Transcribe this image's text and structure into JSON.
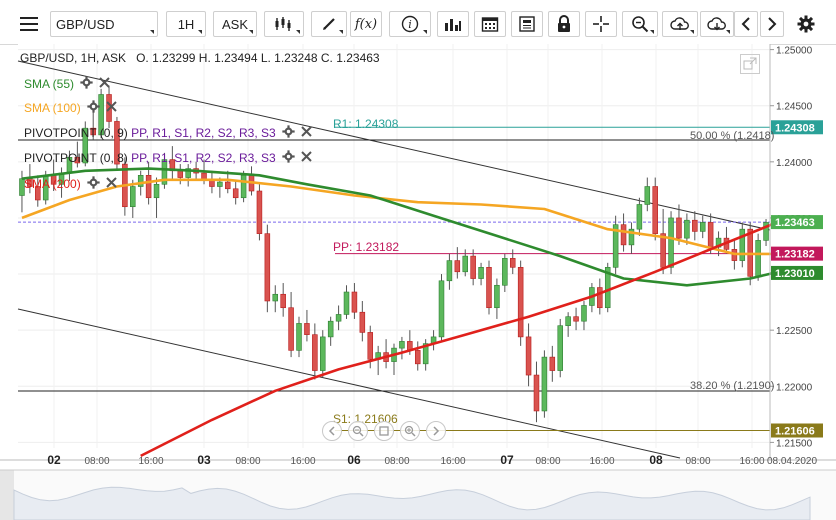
{
  "toolbar": {
    "symbol": "GBP/USD",
    "timeframe": "1H",
    "price_type": "ASK",
    "fx_label": "f(x)"
  },
  "info": {
    "symbol_line": "GBP/USD, 1H, ASK",
    "ohlc": "O. 1.23299 H. 1.23494 L. 1.23248 C. 1.23463"
  },
  "indicators": [
    {
      "label": "SMA (55)",
      "color": "#2e8b2e"
    },
    {
      "label": "SMA (100)",
      "color": "#f5a623"
    },
    {
      "label": "PIVOTPOINT (0, 9)",
      "levels": "PP, R1, S1, R2, S2, R3, S3",
      "color": "#222222"
    },
    {
      "label": "PIVOTPOINT (0, 8)",
      "levels": "PP, R1, S1, R2, S2, R3, S3",
      "color": "#222222"
    },
    {
      "label": "SMA (200)",
      "color": "#e0201b"
    }
  ],
  "overlay_labels": {
    "r1": "R1: 1.24308",
    "pp": "PP: 1.23182",
    "s1": "S1: 1.21606",
    "fib50": "50.00 % (1.2418)",
    "fib382": "38.20 % (1.2190)"
  },
  "price_boxes": [
    {
      "value": "1.24308",
      "price": 1.24308,
      "color": "#2aa198",
      "text_color": "#ffffff"
    },
    {
      "value": "1.23463",
      "price": 1.23463,
      "color": "#4caf50",
      "text_color": "#ffffff"
    },
    {
      "value": "1.23182",
      "price": 1.23182,
      "color": "#c2185b",
      "text_color": "#ffffff"
    },
    {
      "value": "1.23010",
      "price": 1.2301,
      "color": "#2e8b2e",
      "text_color": "#ffffff"
    },
    {
      "value": "1.21606",
      "price": 1.21606,
      "color": "#8a7a1a",
      "text_color": "#ffffff"
    }
  ],
  "chart_data": {
    "type": "candlestick",
    "ylim": [
      1.2145,
      1.2505
    ],
    "y_ticks": [
      "1.25000",
      "1.24500",
      "1.24000",
      "1.23500",
      "1.23000",
      "1.22500",
      "1.22000",
      "1.21500"
    ],
    "x_ticks": [
      "02",
      "08:00",
      "16:00",
      "03",
      "08:00",
      "16:00",
      "06",
      "08:00",
      "16:00",
      "07",
      "08:00",
      "16:00",
      "08",
      "08:00",
      "16:00",
      "08.04.2020"
    ],
    "last_price": 1.23463,
    "candles": [
      [
        1.237,
        1.2392,
        1.2355,
        1.2385
      ],
      [
        1.2385,
        1.2398,
        1.2372,
        1.2378
      ],
      [
        1.2378,
        1.2388,
        1.236,
        1.2366
      ],
      [
        1.2366,
        1.2392,
        1.2362,
        1.2388
      ],
      [
        1.2388,
        1.2402,
        1.2374,
        1.238
      ],
      [
        1.238,
        1.2395,
        1.2368,
        1.239
      ],
      [
        1.239,
        1.241,
        1.2383,
        1.2404
      ],
      [
        1.2404,
        1.2418,
        1.2395,
        1.2399
      ],
      [
        1.2399,
        1.2436,
        1.2396,
        1.243
      ],
      [
        1.243,
        1.2446,
        1.242,
        1.2424
      ],
      [
        1.2424,
        1.2465,
        1.2421,
        1.246
      ],
      [
        1.246,
        1.2468,
        1.243,
        1.2436
      ],
      [
        1.2436,
        1.244,
        1.2392,
        1.2398
      ],
      [
        1.2398,
        1.2404,
        1.2352,
        1.236
      ],
      [
        1.236,
        1.2384,
        1.235,
        1.2378
      ],
      [
        1.2378,
        1.2392,
        1.237,
        1.2388
      ],
      [
        1.2388,
        1.24,
        1.2362,
        1.2368
      ],
      [
        1.2368,
        1.2386,
        1.235,
        1.238
      ],
      [
        1.238,
        1.2408,
        1.2376,
        1.2402
      ],
      [
        1.2402,
        1.2414,
        1.2385,
        1.2392
      ],
      [
        1.2392,
        1.2398,
        1.238,
        1.2386
      ],
      [
        1.2386,
        1.2398,
        1.2378,
        1.2394
      ],
      [
        1.2394,
        1.24,
        1.2385,
        1.239
      ],
      [
        1.239,
        1.2402,
        1.238,
        1.2384
      ],
      [
        1.2384,
        1.2392,
        1.2372,
        1.2378
      ],
      [
        1.2378,
        1.2386,
        1.2368,
        1.2382
      ],
      [
        1.2382,
        1.2392,
        1.2372,
        1.2376
      ],
      [
        1.2376,
        1.2384,
        1.2362,
        1.2368
      ],
      [
        1.2368,
        1.2392,
        1.2364,
        1.2388
      ],
      [
        1.2388,
        1.2396,
        1.237,
        1.2374
      ],
      [
        1.2374,
        1.238,
        1.233,
        1.2336
      ],
      [
        1.2336,
        1.2344,
        1.2266,
        1.2276
      ],
      [
        1.2276,
        1.229,
        1.2266,
        1.2282
      ],
      [
        1.2282,
        1.2292,
        1.2262,
        1.227
      ],
      [
        1.227,
        1.2284,
        1.2226,
        1.2232
      ],
      [
        1.2232,
        1.2262,
        1.2226,
        1.2256
      ],
      [
        1.2256,
        1.2268,
        1.224,
        1.2246
      ],
      [
        1.2246,
        1.2256,
        1.2206,
        1.2214
      ],
      [
        1.2214,
        1.225,
        1.2208,
        1.2244
      ],
      [
        1.2244,
        1.2262,
        1.2236,
        1.2258
      ],
      [
        1.2258,
        1.2272,
        1.225,
        1.2264
      ],
      [
        1.2264,
        1.229,
        1.226,
        1.2284
      ],
      [
        1.2284,
        1.2292,
        1.226,
        1.2266
      ],
      [
        1.2266,
        1.2276,
        1.224,
        1.2248
      ],
      [
        1.2248,
        1.2254,
        1.2216,
        1.2224
      ],
      [
        1.2224,
        1.2236,
        1.221,
        1.223
      ],
      [
        1.223,
        1.2242,
        1.2216,
        1.2222
      ],
      [
        1.2222,
        1.2238,
        1.221,
        1.2234
      ],
      [
        1.2234,
        1.2244,
        1.2224,
        1.224
      ],
      [
        1.224,
        1.225,
        1.2228,
        1.2232
      ],
      [
        1.2232,
        1.224,
        1.2214,
        1.222
      ],
      [
        1.222,
        1.2242,
        1.2214,
        1.2238
      ],
      [
        1.2238,
        1.225,
        1.2232,
        1.2244
      ],
      [
        1.2244,
        1.23,
        1.224,
        1.2294
      ],
      [
        1.2294,
        1.2318,
        1.2286,
        1.2312
      ],
      [
        1.2312,
        1.2324,
        1.2296,
        1.2302
      ],
      [
        1.2302,
        1.2322,
        1.2298,
        1.2316
      ],
      [
        1.2316,
        1.2322,
        1.229,
        1.2296
      ],
      [
        1.2296,
        1.231,
        1.229,
        1.2306
      ],
      [
        1.2306,
        1.2312,
        1.2264,
        1.227
      ],
      [
        1.227,
        1.2296,
        1.226,
        1.229
      ],
      [
        1.229,
        1.2318,
        1.2284,
        1.2314
      ],
      [
        1.2314,
        1.2322,
        1.23,
        1.2306
      ],
      [
        1.2306,
        1.2312,
        1.2236,
        1.2244
      ],
      [
        1.2244,
        1.2256,
        1.22,
        1.221
      ],
      [
        1.221,
        1.2222,
        1.2168,
        1.2178
      ],
      [
        1.2178,
        1.2232,
        1.2172,
        1.2226
      ],
      [
        1.2226,
        1.2236,
        1.2204,
        1.2214
      ],
      [
        1.2214,
        1.226,
        1.2208,
        1.2254
      ],
      [
        1.2254,
        1.2266,
        1.2244,
        1.2262
      ],
      [
        1.2262,
        1.227,
        1.225,
        1.2258
      ],
      [
        1.2258,
        1.2276,
        1.225,
        1.2272
      ],
      [
        1.2272,
        1.2292,
        1.2266,
        1.2288
      ],
      [
        1.2288,
        1.2296,
        1.2264,
        1.227
      ],
      [
        1.227,
        1.231,
        1.2266,
        1.2306
      ],
      [
        1.2306,
        1.2352,
        1.23,
        1.2344
      ],
      [
        1.2344,
        1.2354,
        1.232,
        1.2326
      ],
      [
        1.2326,
        1.2346,
        1.2318,
        1.234
      ],
      [
        1.234,
        1.2368,
        1.2334,
        1.2362
      ],
      [
        1.2362,
        1.2386,
        1.2356,
        1.2378
      ],
      [
        1.2378,
        1.2386,
        1.233,
        1.2336
      ],
      [
        1.2336,
        1.2358,
        1.23,
        1.2306
      ],
      [
        1.2306,
        1.2356,
        1.23,
        1.235
      ],
      [
        1.235,
        1.2362,
        1.2326,
        1.2332
      ],
      [
        1.2332,
        1.2354,
        1.2326,
        1.2348
      ],
      [
        1.2348,
        1.2356,
        1.233,
        1.2338
      ],
      [
        1.2338,
        1.2352,
        1.2332,
        1.2346
      ],
      [
        1.2346,
        1.2354,
        1.2318,
        1.2324
      ],
      [
        1.2324,
        1.2338,
        1.2316,
        1.2332
      ],
      [
        1.2332,
        1.2342,
        1.2318,
        1.2322
      ],
      [
        1.2322,
        1.233,
        1.2304,
        1.2312
      ],
      [
        1.2312,
        1.2346,
        1.2306,
        1.234
      ],
      [
        1.234,
        1.2346,
        1.229,
        1.2298
      ],
      [
        1.2298,
        1.2336,
        1.2294,
        1.233
      ],
      [
        1.233,
        1.2349,
        1.2325,
        1.2346
      ]
    ],
    "sma55": [
      [
        0,
        1.2385
      ],
      [
        8,
        1.2392
      ],
      [
        16,
        1.2394
      ],
      [
        22,
        1.2392
      ],
      [
        30,
        1.2388
      ],
      [
        36,
        1.238
      ],
      [
        44,
        1.237
      ],
      [
        52,
        1.2352
      ],
      [
        60,
        1.2334
      ],
      [
        68,
        1.2316
      ],
      [
        76,
        1.2296
      ],
      [
        84,
        1.229
      ],
      [
        92,
        1.2296
      ],
      [
        95,
        1.2301
      ]
    ],
    "sma100": [
      [
        0,
        1.235
      ],
      [
        6,
        1.2366
      ],
      [
        12,
        1.2378
      ],
      [
        18,
        1.2384
      ],
      [
        26,
        1.2384
      ],
      [
        34,
        1.2378
      ],
      [
        42,
        1.237
      ],
      [
        50,
        1.2364
      ],
      [
        58,
        1.2362
      ],
      [
        66,
        1.2358
      ],
      [
        74,
        1.234
      ],
      [
        82,
        1.2332
      ],
      [
        90,
        1.2318
      ],
      [
        95,
        1.2318
      ]
    ],
    "sma200": [
      [
        15,
        1.2138
      ],
      [
        24,
        1.217
      ],
      [
        32,
        1.2196
      ],
      [
        40,
        1.2215
      ],
      [
        48,
        1.223
      ],
      [
        56,
        1.2246
      ],
      [
        64,
        1.2262
      ],
      [
        72,
        1.228
      ],
      [
        80,
        1.2302
      ],
      [
        88,
        1.2325
      ],
      [
        95,
        1.2345
      ]
    ],
    "levels": {
      "r1": 1.24308,
      "pp": 1.23182,
      "s1": 1.21606,
      "fib50": 1.2418,
      "fib382": 1.219
    }
  }
}
